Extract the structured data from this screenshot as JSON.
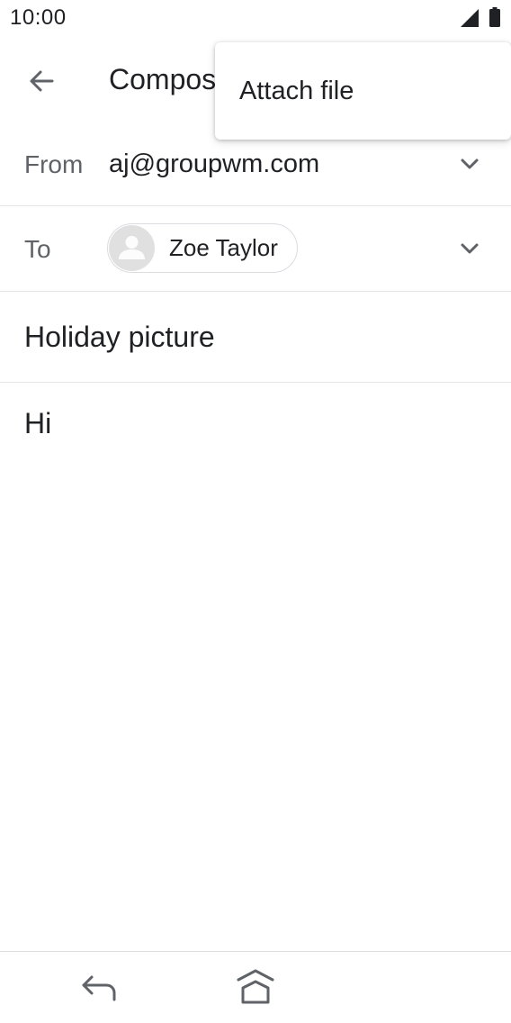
{
  "status_bar": {
    "time": "10:00"
  },
  "app_bar": {
    "title": "Compose"
  },
  "from_field": {
    "label": "From",
    "value": "aj@groupwm.com"
  },
  "to_field": {
    "label": "To",
    "recipients": [
      {
        "name": "Zoe Taylor"
      }
    ]
  },
  "subject": {
    "value": "Holiday picture"
  },
  "body": {
    "value": "Hi"
  },
  "overflow_menu": {
    "items": [
      {
        "label": "Attach file"
      }
    ]
  },
  "icons": {
    "status": [
      "signal-icon",
      "battery-icon"
    ],
    "app_bar": [
      "back-arrow-icon"
    ],
    "fields": [
      "chevron-down-icon",
      "avatar-placeholder-icon"
    ],
    "nav": [
      "nav-back-icon",
      "nav-home-icon"
    ]
  }
}
